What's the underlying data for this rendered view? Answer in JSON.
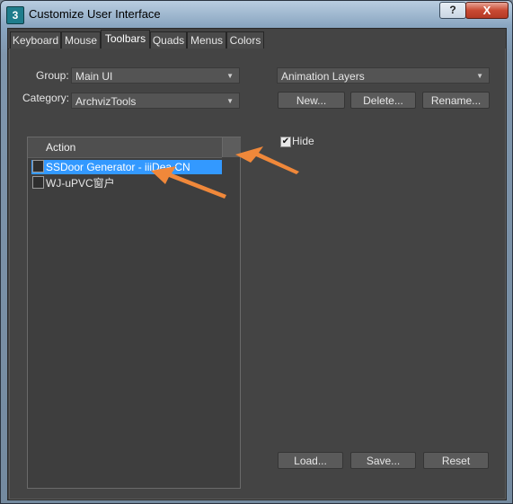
{
  "window": {
    "title": "Customize User Interface",
    "app_icon": "3",
    "help_label": "?",
    "close_label": "X"
  },
  "tabs": [
    {
      "label": "Keyboard"
    },
    {
      "label": "Mouse"
    },
    {
      "label": "Toolbars",
      "active": true
    },
    {
      "label": "Quads"
    },
    {
      "label": "Menus"
    },
    {
      "label": "Colors"
    }
  ],
  "toolbars": {
    "group_label": "Group:",
    "group_value": "Main UI",
    "category_label": "Category:",
    "category_value": "ArchvizTools",
    "action_header": "Action",
    "actions": [
      {
        "label": "SSDoor Generator - iiiDea.CN",
        "selected": true
      },
      {
        "label": "WJ-uPVC窗户",
        "selected": false
      }
    ],
    "toolbar_select": "Animation Layers",
    "new_label": "New...",
    "delete_label": "Delete...",
    "rename_label": "Rename...",
    "hide_label": "Hide",
    "hide_checked": true,
    "load_label": "Load...",
    "save_label": "Save...",
    "reset_label": "Reset"
  },
  "colors": {
    "selection": "#3399ff",
    "annotation_arrow": "#f0883a"
  }
}
